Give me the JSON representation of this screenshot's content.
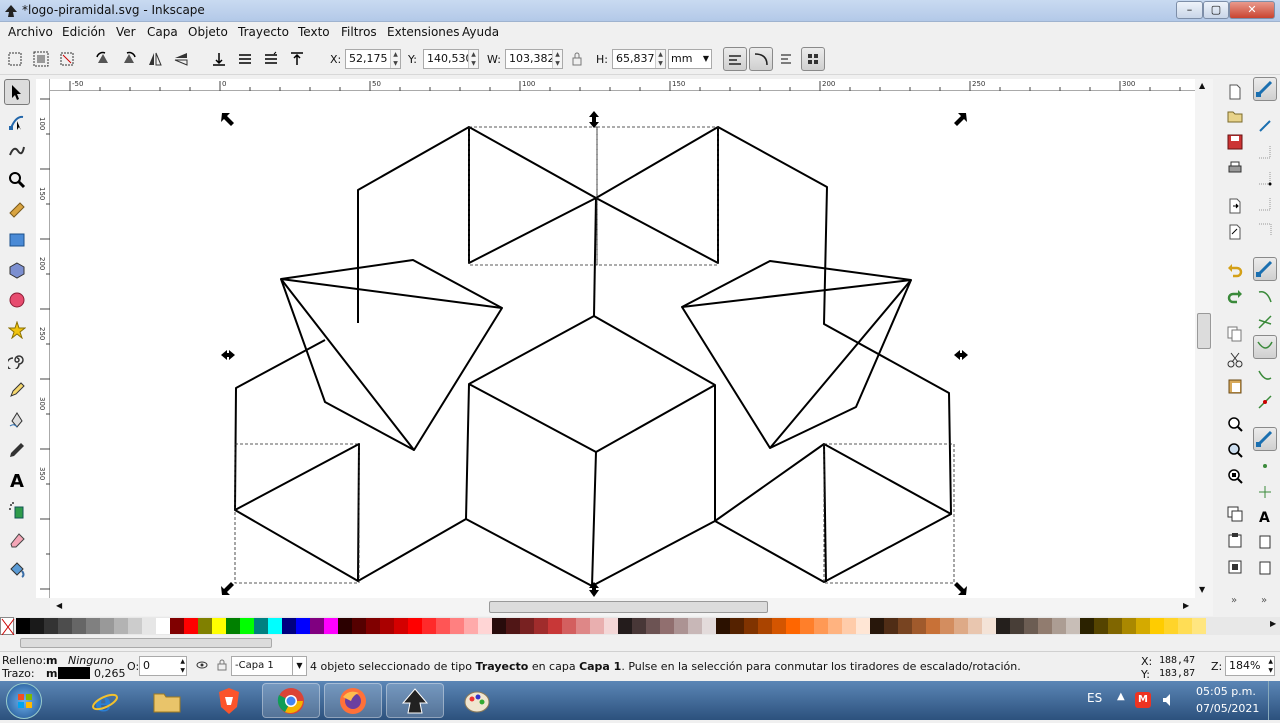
{
  "window": {
    "title": "*logo-piramidal.svg - Inkscape",
    "minimize": "–",
    "maximize": "▢",
    "close": "✕"
  },
  "menu": [
    "Archivo",
    "Edición",
    "Ver",
    "Capa",
    "Objeto",
    "Trayecto",
    "Texto",
    "Filtros",
    "Extensiones",
    "Ayuda"
  ],
  "ctrl": {
    "x_label": "X:",
    "x": "52,175",
    "y_label": "Y:",
    "y": "140,530",
    "w_label": "W:",
    "w": "103,382",
    "h_label": "H:",
    "h": "65,837",
    "unit": "mm"
  },
  "tools": [
    "selector-tool",
    "node-tool",
    "tweak-tool",
    "zoom-tool",
    "measure-tool",
    "rect-tool",
    "3dbox-tool",
    "ellipse-tool",
    "star-tool",
    "spiral-tool",
    "pencil-tool",
    "pen-tool",
    "calligraphy-tool",
    "text-tool",
    "spray-tool",
    "eraser-tool",
    "bucket-tool"
  ],
  "ruler": {
    "top_ticks": [
      "-50",
      "0",
      "50",
      "100",
      "150",
      "200",
      "250",
      "300"
    ],
    "left_ticks": [
      "100",
      "150",
      "200",
      "250",
      "300",
      "350"
    ]
  },
  "palette": {
    "colors": [
      "#000000",
      "#1a1a1a",
      "#333333",
      "#4d4d4d",
      "#666666",
      "#808080",
      "#999999",
      "#b3b3b3",
      "#cccccc",
      "#e6e6e6",
      "#ffffff",
      "#800000",
      "#ff0000",
      "#808000",
      "#ffff00",
      "#008000",
      "#00ff00",
      "#008080",
      "#00ffff",
      "#000080",
      "#0000ff",
      "#800080",
      "#ff00ff",
      "#2b0000",
      "#550000",
      "#800000",
      "#aa0000",
      "#d40000",
      "#ff0000",
      "#ff2a2a",
      "#ff5555",
      "#ff8080",
      "#ffaaaa",
      "#ffd5d5",
      "#280b0b",
      "#501616",
      "#782121",
      "#a02c2c",
      "#c83737",
      "#d35f5f",
      "#de8787",
      "#e9afaf",
      "#f4d7d7",
      "#241c1c",
      "#483737",
      "#6c5353",
      "#916f6f",
      "#ac9393",
      "#c8b7b7",
      "#e3dbdb",
      "#2b1100",
      "#552200",
      "#803300",
      "#aa4400",
      "#d45500",
      "#ff6600",
      "#ff7f2a",
      "#ff9955",
      "#ffb380",
      "#ffccaa",
      "#ffe6d5",
      "#28170b",
      "#502d16",
      "#784421",
      "#a05a2c",
      "#c87137",
      "#d38d5f",
      "#deaa87",
      "#e9c6af",
      "#f4e3d7",
      "#241f1c",
      "#483e37",
      "#6c5d53",
      "#917c6f",
      "#ac9d93",
      "#c8beb7",
      "#2b2200",
      "#554400",
      "#806600",
      "#aa8800",
      "#d4aa00",
      "#ffcc00",
      "#ffd42a",
      "#ffdd55",
      "#ffe680"
    ]
  },
  "status": {
    "fill_label": "Relleno:",
    "fill_value": "m",
    "fill_text": "Ninguno",
    "stroke_label": "Trazo:",
    "stroke_value": "m",
    "stroke_width": "0,265",
    "opacity_label": "O:",
    "opacity": "0",
    "layer": "-Capa 1",
    "message_pre": "4 objeto seleccionado de tipo",
    "message_type": "Trayecto",
    "message_mid": "en capa",
    "message_layer": "Capa 1",
    "message_post": ". Pulse en la selección para conmutar los tiradores de escalado/rotación.",
    "cursor_x_label": "X:",
    "cursor_x": "188,47",
    "cursor_y_label": "Y:",
    "cursor_y": "183,87",
    "zoom_label": "Z:",
    "zoom": "184%"
  },
  "taskbar": {
    "apps": [
      "start-orb",
      "internet-explorer",
      "file-explorer",
      "brave",
      "chrome",
      "firefox",
      "inkscape",
      "paint"
    ],
    "lang": "ES",
    "time": "05:05 p.m.",
    "date": "07/05/2021"
  }
}
